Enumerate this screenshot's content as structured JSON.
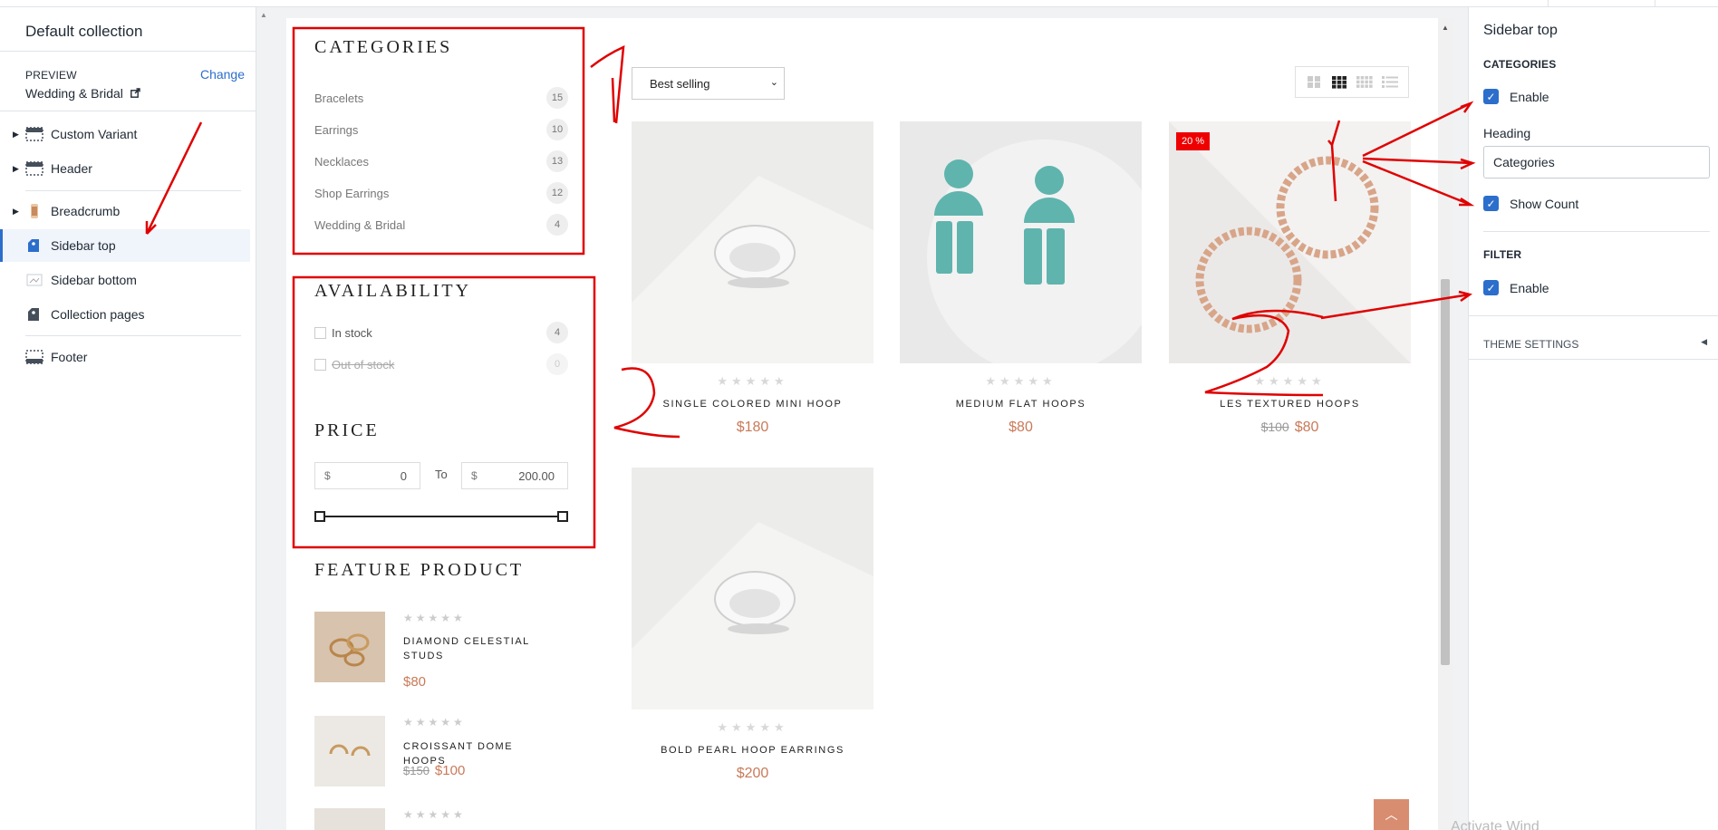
{
  "left_panel": {
    "title": "Default collection",
    "preview_label": "PREVIEW",
    "change_link": "Change",
    "preview_value": "Wedding & Bridal",
    "items": [
      {
        "label": "Custom Variant"
      },
      {
        "label": "Header"
      },
      {
        "label": "Breadcrumb"
      },
      {
        "label": "Sidebar top"
      },
      {
        "label": "Sidebar bottom"
      },
      {
        "label": "Collection pages"
      },
      {
        "label": "Footer"
      }
    ]
  },
  "store": {
    "categories_heading": "CATEGORIES",
    "categories": [
      {
        "name": "Bracelets",
        "count": "15"
      },
      {
        "name": "Earrings",
        "count": "10"
      },
      {
        "name": "Necklaces",
        "count": "13"
      },
      {
        "name": "Shop Earrings",
        "count": "12"
      },
      {
        "name": "Wedding & Bridal",
        "count": "4"
      }
    ],
    "availability_heading": "AVAILABILITY",
    "availability": [
      {
        "name": "In stock",
        "count": "4"
      },
      {
        "name": "Out of stock",
        "count": "0"
      }
    ],
    "price_heading": "PRICE",
    "price_currency": "$",
    "price_min": "0",
    "price_to": "To",
    "price_max": "200.00",
    "feature_heading": "FEATURE PRODUCT",
    "feature_products": [
      {
        "name": "DIAMOND CELESTIAL STUDS",
        "price": "$80",
        "old_price": ""
      },
      {
        "name": "CROISSANT DOME HOOPS",
        "price": "$100",
        "old_price": "$150"
      }
    ],
    "sort_label": "Best selling",
    "stars": "★★★★★",
    "products": [
      {
        "name": "SINGLE COLORED MINI HOOP",
        "price": "$180",
        "old_price": ""
      },
      {
        "name": "MEDIUM FLAT HOOPS",
        "price": "$80",
        "old_price": ""
      },
      {
        "name": "LES TEXTURED HOOPS",
        "price": "$80",
        "old_price": "$100",
        "badge": "20 %"
      },
      {
        "name": "BOLD PEARL HOOP EARRINGS",
        "price": "$200",
        "old_price": ""
      }
    ],
    "back_to_top_icon": "chevron-up-icon"
  },
  "right_panel": {
    "title": "Sidebar top",
    "categories_section": "CATEGORIES",
    "enable_label": "Enable",
    "heading_label": "Heading",
    "heading_value": "Categories",
    "show_count_label": "Show Count",
    "filter_section": "FILTER",
    "filter_enable_label": "Enable",
    "theme_settings": "THEME SETTINGS",
    "watermark": "Activate Wind"
  },
  "colors": {
    "accent": "#2c6ecb",
    "price": "#c97a59",
    "annotation": "#e00000",
    "badge": "#ee0000"
  }
}
